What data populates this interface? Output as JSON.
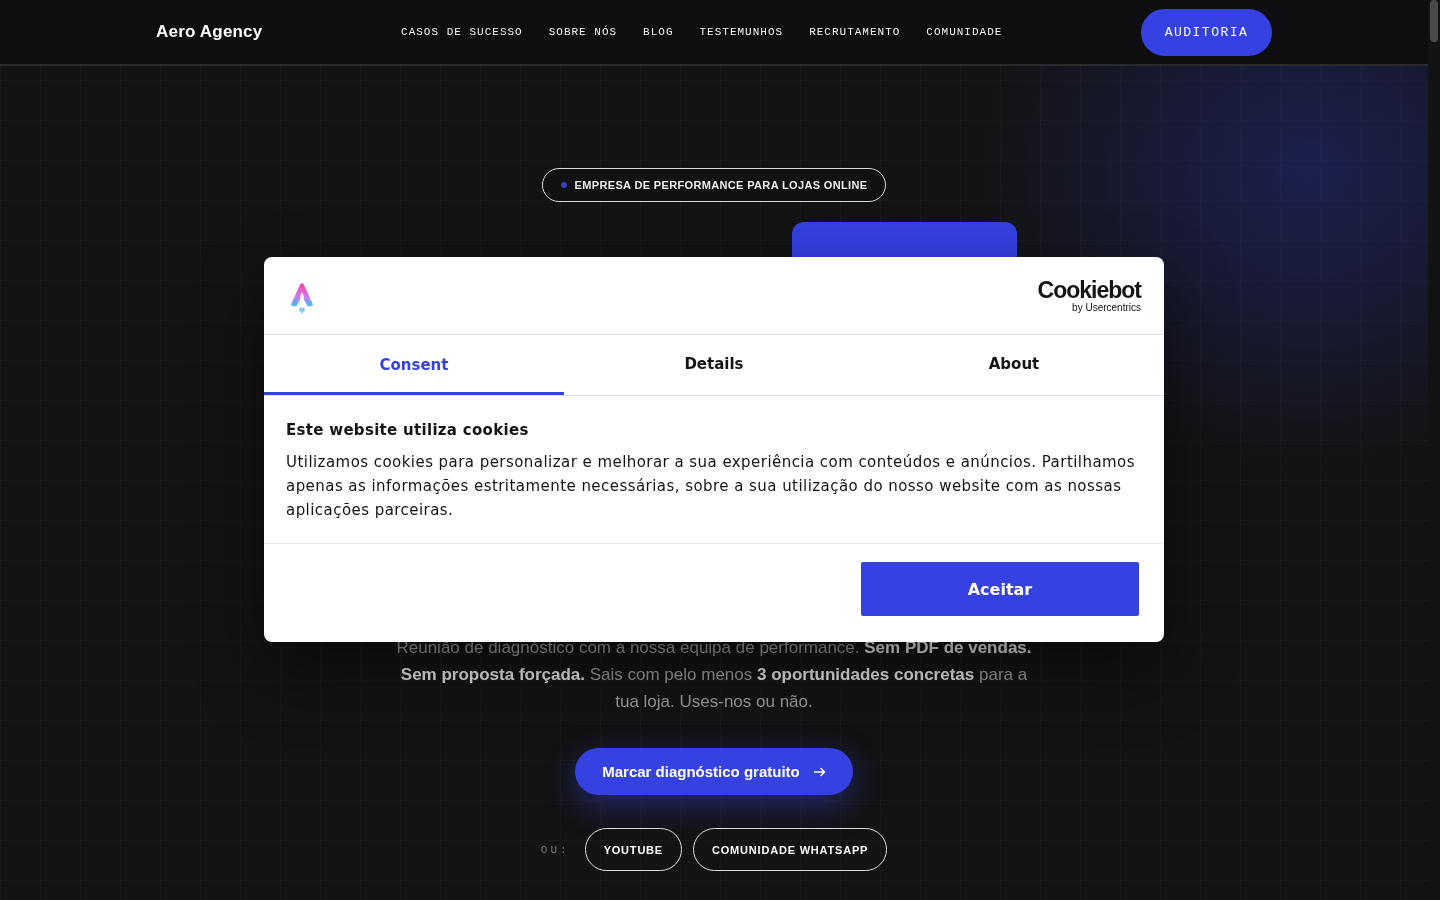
{
  "header": {
    "logo": "Aero Agency",
    "nav": [
      "CASOS DE SUCESSO",
      "SOBRE NÓS",
      "BLOG",
      "TESTEMUNHOS",
      "RECRUTAMENTO",
      "COMUNIDADE"
    ],
    "cta": "AUDITORIA"
  },
  "hero": {
    "badge": "EMPRESA DE PERFORMANCE PARA LOJAS ONLINE",
    "description": "Reunião de diagnóstico com a nossa equipa de performance. **Sem PDF de vendas. Sem proposta forçada.** Sais com pelo menos **3 oportunidades concretas** para a tua loja. Uses-nos ou não.",
    "cta": "Marcar diagnóstico gratuito",
    "alt_label": "OU:",
    "alt_links": [
      "YOUTUBE",
      "COMUNIDADE WHATSAPP"
    ]
  },
  "cookie_dialog": {
    "brand": {
      "name": "Cookiebot",
      "byline": "by Usercentrics"
    },
    "tabs": [
      {
        "label": "Consent",
        "selected": true
      },
      {
        "label": "Details",
        "selected": false
      },
      {
        "label": "About",
        "selected": false
      }
    ],
    "title": "Este website utiliza cookies",
    "message": "Utilizamos cookies para personalizar e melhorar a sua experiência com conteúdos e anúncios. Partilhamos apenas as informações estritamente necessárias, sobre a sua utilização do nosso website com as nossas aplicações parceiras.",
    "accept_button": "Aceitar"
  }
}
